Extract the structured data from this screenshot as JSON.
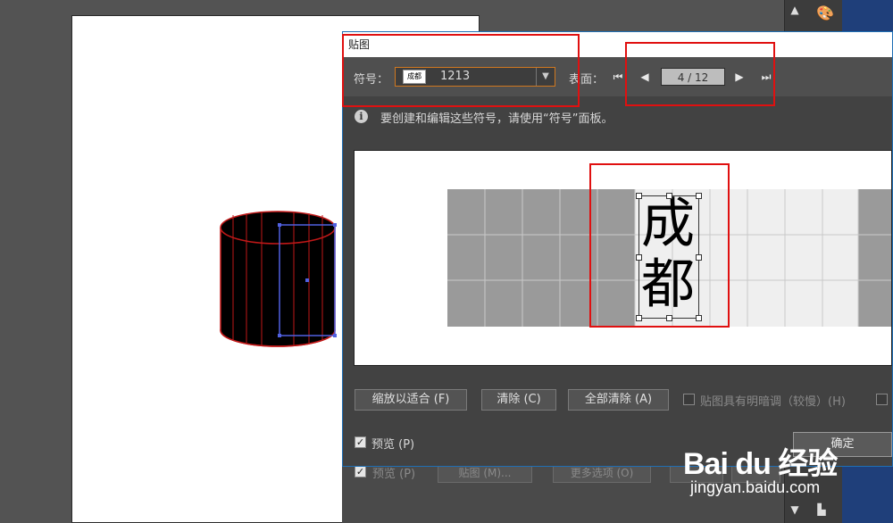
{
  "dialog": {
    "title": "贴图",
    "symbol_label": "符号：",
    "symbol_value": "1213",
    "symbol_thumb_text": "成都",
    "surface_label": "表面：",
    "surface_value": "4 / 12",
    "info_text": "要创建和编辑这些符号，请使用“符号”面板。",
    "preview_text_top": "成",
    "preview_text_bottom": "都",
    "buttons": {
      "fit": "缩放以适合 (F)",
      "clear": "清除 (C)",
      "clear_all": "全部清除 (A)",
      "ok": "确定"
    },
    "shade_checkbox_label": "贴图具有明暗调（较慢）(H)",
    "preview_checkbox_label": "预览 (P)"
  },
  "behind_dialog": {
    "preview_label": "预览 (P)",
    "map_button": "贴图 (M)...",
    "more_options_button": "更多选项 (O)"
  },
  "watermark": {
    "logo": "Bai du 经验",
    "url": "jingyan.baidu.com"
  },
  "colors": {
    "highlight_red": "#e01010",
    "dialog_border": "#1f6fb5",
    "select_border": "#d07820"
  }
}
